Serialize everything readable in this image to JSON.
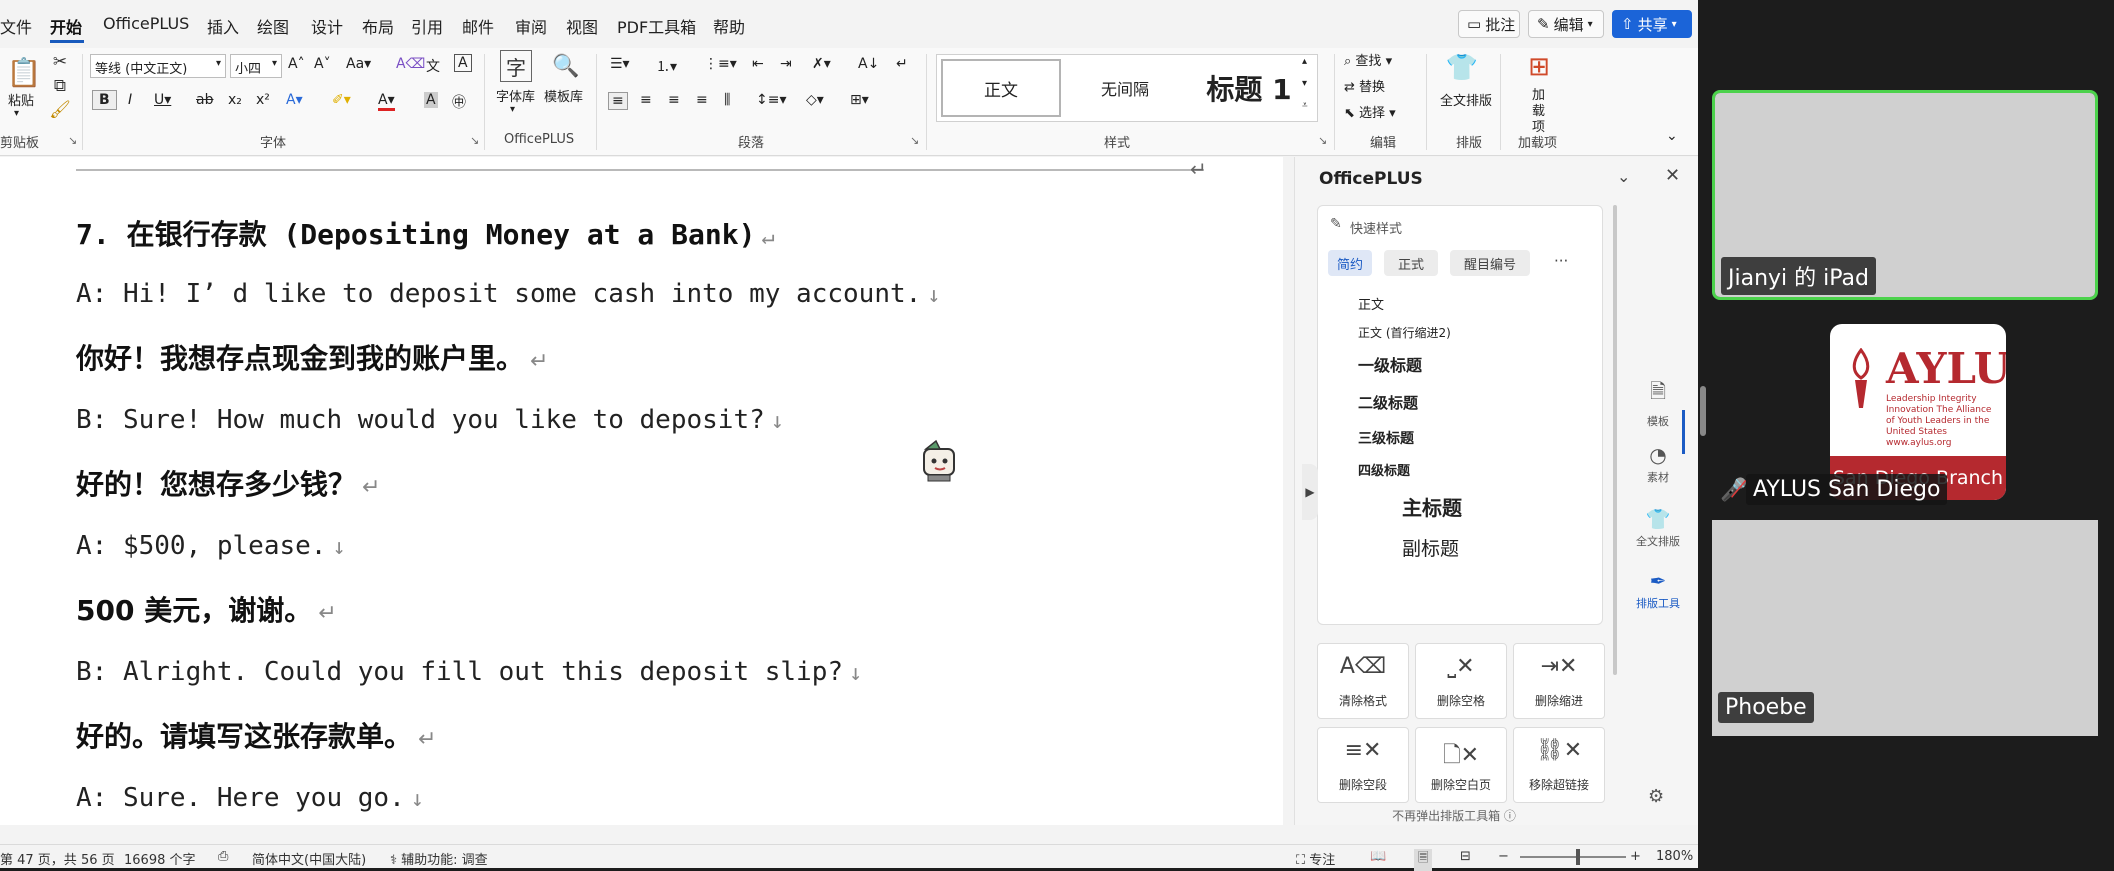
{
  "menubar": {
    "tabs": [
      "文件",
      "开始",
      "OfficePLUS",
      "插入",
      "绘图",
      "设计",
      "布局",
      "引用",
      "邮件",
      "审阅",
      "视图",
      "PDF工具箱",
      "帮助"
    ],
    "active_tab": "开始",
    "comment_label": "批注",
    "edit_label": "编辑",
    "share_label": "共享"
  },
  "ribbon": {
    "clipboard": {
      "paste_label": "粘贴",
      "group": "剪贴板"
    },
    "font": {
      "font_name": "等线 (中文正文)",
      "font_size": "小四",
      "group": "字体"
    },
    "officeplus": {
      "charlib_label": "字体库",
      "template_label": "模板库",
      "group": "OfficePLUS"
    },
    "paragraph": {
      "group": "段落"
    },
    "styles": {
      "normal": "正文",
      "nospace": "无间隔",
      "h1": "标题 1",
      "group": "样式"
    },
    "editing": {
      "find": "查找",
      "replace": "替换",
      "select": "选择",
      "group": "编辑"
    },
    "layout": {
      "label": "全文排版",
      "group": "排版"
    },
    "addins": {
      "label": "加载项",
      "group": "加载项"
    }
  },
  "document": {
    "lines": [
      {
        "text": "7. 在银行存款 (Depositing Money at a Bank)",
        "mark": "↵"
      },
      {
        "text": "A: Hi! I’ d like to deposit some cash into my account.",
        "mark": "↓"
      },
      {
        "text": "你好！我想存点现金到我的账户里。",
        "mark": "↵"
      },
      {
        "text": "B: Sure! How much would you like to deposit?",
        "mark": "↓"
      },
      {
        "text": "好的！您想存多少钱？",
        "mark": "↵"
      },
      {
        "text": "A: $500, please.",
        "mark": "↓"
      },
      {
        "text": "500 美元，谢谢。",
        "mark": "↵"
      },
      {
        "text": "B: Alright. Could you fill out this deposit slip?",
        "mark": "↓"
      },
      {
        "text": "好的。请填写这张存款单。",
        "mark": "↵"
      },
      {
        "text": "A: Sure. Here you go.",
        "mark": "↓"
      }
    ]
  },
  "panel": {
    "title": "OfficePLUS",
    "quick_styles_title": "快速样式",
    "tabs": [
      "简约",
      "正式",
      "醒目编号"
    ],
    "more": "···",
    "items": [
      "正文",
      "正文 (首行缩进2)",
      "一级标题",
      "二级标题",
      "三级标题",
      "四级标题",
      "主标题",
      "副标题"
    ],
    "tools": [
      "清除格式",
      "删除空格",
      "删除缩进",
      "删除空段",
      "删除空白页",
      "移除超链接"
    ],
    "footer": "不再弹出排版工具箱 ⓘ",
    "rail": [
      "模板",
      "素材",
      "全文排版",
      "排版工具"
    ]
  },
  "statusbar": {
    "page": "第 47 页，共 56 页",
    "words": "16698 个字",
    "language": "简体中文(中国大陆)",
    "accessibility": "辅助功能: 调查",
    "focus": "专注",
    "zoom": "180%"
  },
  "video": {
    "participants": [
      {
        "name": "Jianyi 的 iPad"
      },
      {
        "name": "AYLUS San Diego",
        "muted": true
      },
      {
        "name": "Phoebe"
      }
    ],
    "aylus_logo": {
      "wordmark": "AYLUS",
      "tagline": "Leadership Integrity Innovation The Alliance of Youth Leaders in the United States www.aylus.org",
      "branch": "San Diego Branch"
    }
  },
  "colors": {
    "accent": "#185abd",
    "share": "#1b64d8",
    "speaker_border": "#4cd24c",
    "aylus_red": "#b5292f"
  }
}
